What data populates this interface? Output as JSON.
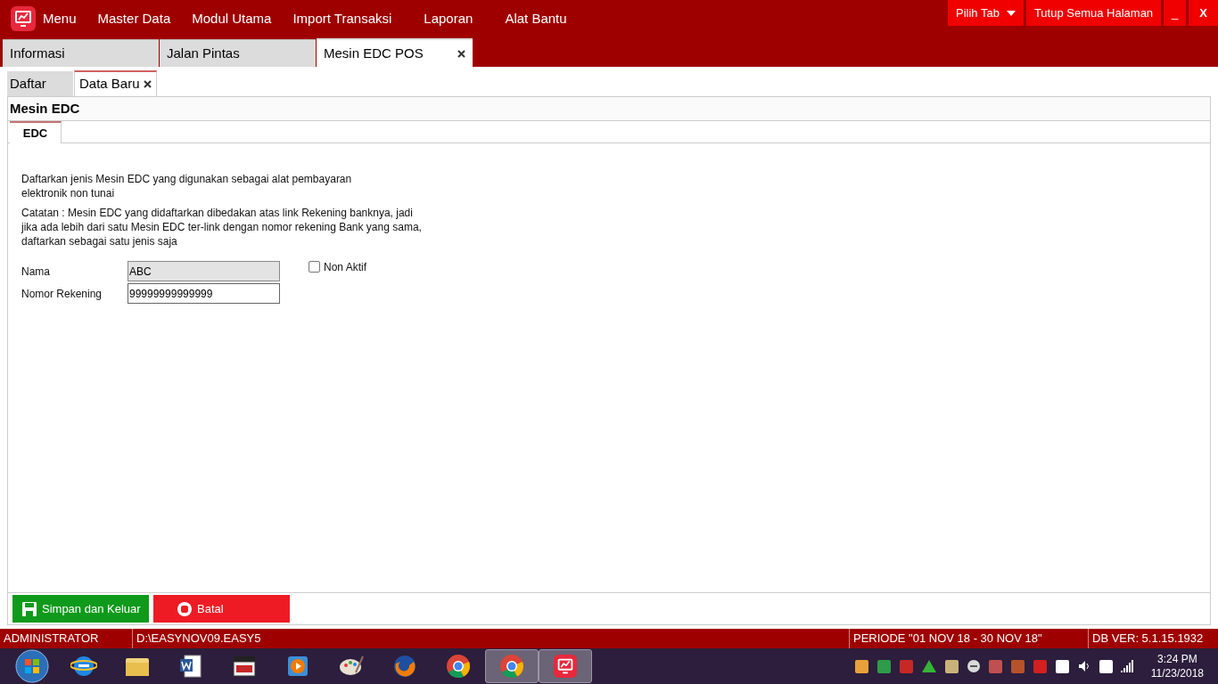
{
  "menu_bar": {
    "items": [
      "Menu",
      "Master Data",
      "Modul Utama",
      "Import Transaksi",
      "Laporan",
      "Alat Bantu"
    ],
    "buttons": [
      {
        "label": "Pilih Tab",
        "kind": "dropdown"
      },
      {
        "label": "Tutup Semua Halaman",
        "kind": "plain"
      },
      {
        "label": "_",
        "kind": "plain"
      },
      {
        "label": "X",
        "kind": "bold"
      }
    ]
  },
  "page_tabs": [
    {
      "label": "Informasi",
      "selected": false,
      "closable": false
    },
    {
      "label": "Jalan Pintas",
      "selected": false,
      "closable": false
    },
    {
      "label": "Mesin EDC POS",
      "selected": true,
      "closable": true
    }
  ],
  "sub_tabs": [
    {
      "label": "Daftar",
      "selected": false,
      "closable": false
    },
    {
      "label": "Data Baru",
      "selected": true,
      "closable": true
    }
  ],
  "form": {
    "title": "Mesin EDC",
    "tabs": [
      {
        "label": "EDC",
        "selected": true
      }
    ],
    "description": "Daftarkan jenis Mesin EDC yang digunakan sebagai alat pembayaran elektronik non tunai",
    "note": "Catatan : Mesin EDC yang didaftarkan dibedakan atas link Rekening banknya, jadi jika ada lebih dari satu Mesin EDC ter-link dengan nomor rekening Bank yang sama, daftarkan sebagai satu jenis saja",
    "fields": [
      {
        "label": "Nama",
        "value": "ABC",
        "disabled": true
      },
      {
        "label": "Nomor Rekening",
        "value": "99999999999999",
        "disabled": false
      }
    ],
    "non_aktif": {
      "label": "Non Aktif",
      "checked": false
    },
    "actions": [
      {
        "label": "Simpan dan Keluar",
        "kind": "save"
      },
      {
        "label": "Batal",
        "kind": "cancel"
      }
    ]
  },
  "status_bar": [
    "ADMINISTRATOR",
    "D:\\EASYNOV09.EASY5",
    "PERIODE \"01 NOV 18 - 30 NOV 18\"",
    "DB VER: 5.1.15.1932"
  ],
  "taskbar": {
    "apps": [
      {
        "kind": "start",
        "open": false
      },
      {
        "kind": "browser",
        "open": false
      },
      {
        "kind": "folder",
        "open": false
      },
      {
        "kind": "word",
        "open": false
      },
      {
        "kind": "media",
        "open": false
      },
      {
        "kind": "player",
        "open": false
      },
      {
        "kind": "paint",
        "open": false
      },
      {
        "kind": "firefox",
        "open": false
      },
      {
        "kind": "chrome",
        "open": false
      },
      {
        "kind": "chrome",
        "open": true
      },
      {
        "kind": "app",
        "open": true
      }
    ],
    "time": "3:24 PM",
    "date": "11/23/2018"
  }
}
